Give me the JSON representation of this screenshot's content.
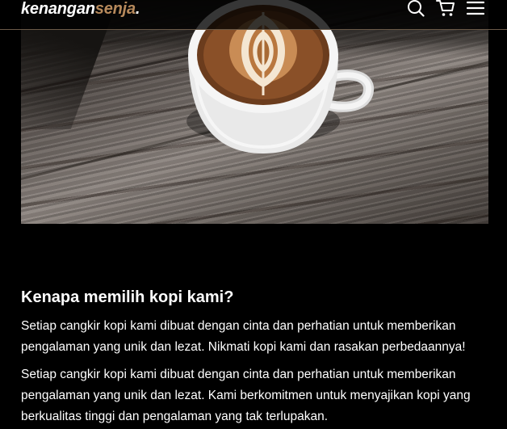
{
  "navbar": {
    "logo": {
      "part1": "kenangan",
      "part2": "senja",
      "part3": "."
    },
    "icons": [
      "search-icon",
      "shopping-cart-icon",
      "menu-icon"
    ]
  },
  "colors": {
    "accent": "#b6895b",
    "background": "#000000",
    "text": "#ffffff"
  },
  "hero": {
    "subject": "latte-art-coffee-cup"
  },
  "about": {
    "heading": "Kenapa memilih kopi kami?",
    "paragraphs": [
      "Setiap cangkir kopi kami dibuat dengan cinta dan perhatian untuk memberikan pengalaman yang unik dan lezat. Nikmati kopi kami dan rasakan perbedaannya!",
      "Setiap cangkir kopi kami dibuat dengan cinta dan perhatian untuk memberikan pengalaman yang unik dan lezat. Kami berkomitmen untuk menyajikan kopi yang berkualitas tinggi dan pengalaman yang tak terlupakan."
    ]
  }
}
